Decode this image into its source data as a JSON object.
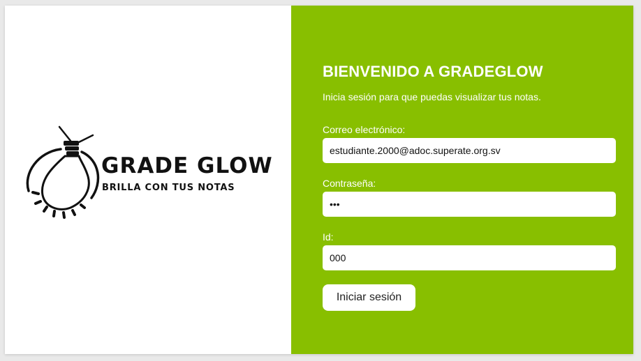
{
  "brand": {
    "name": "GRADE GLOW",
    "tagline": "BRILLA CON TUS NOTAS",
    "logo_icon": "lightbulb-icon"
  },
  "login": {
    "title": "BIENVENIDO A GRADEGLOW",
    "subtitle": "Inicia sesión para que puedas visualizar tus notas.",
    "email_label": "Correo electrónico:",
    "email_value": "estudiante.2000@adoc.superate.org.sv",
    "password_label": "Contraseña:",
    "password_value": "•••",
    "id_label": "Id:",
    "id_value": "000",
    "submit_label": "Iniciar sesión"
  },
  "colors": {
    "accent": "#88bf00",
    "panel_left": "#ffffff"
  }
}
